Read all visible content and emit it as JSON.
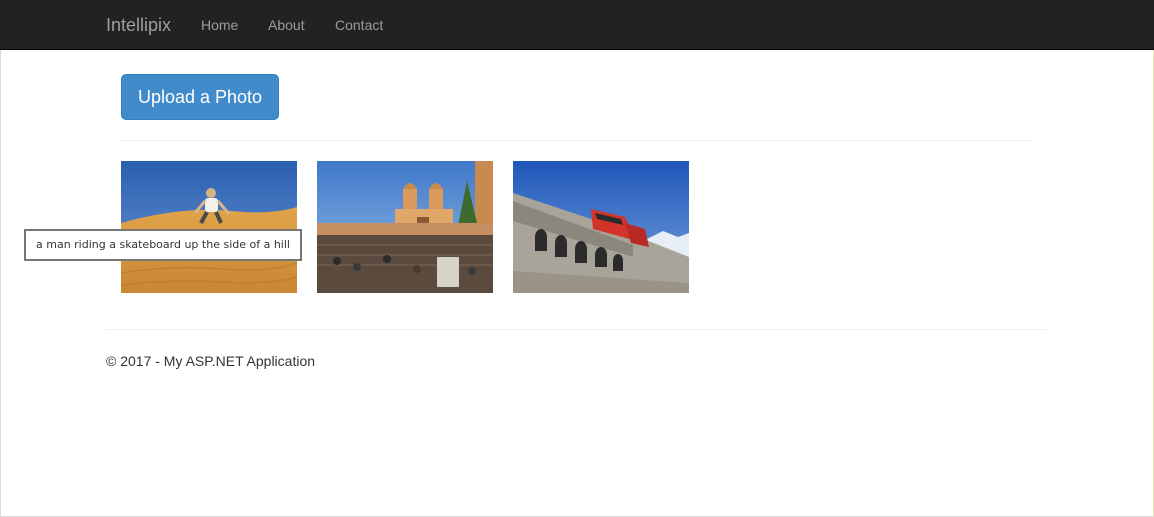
{
  "navbar": {
    "brand": "Intellipix",
    "links": [
      "Home",
      "About",
      "Contact"
    ]
  },
  "main": {
    "upload_label": "Upload a Photo",
    "photos": [
      {
        "description": "desert dune with man"
      },
      {
        "description": "church with steps and crowd"
      },
      {
        "description": "red train on stone viaduct"
      }
    ],
    "tooltip": "a man riding a skateboard up the side of a hill"
  },
  "footer": {
    "text": "© 2017 - My ASP.NET Application"
  },
  "colors": {
    "navbar_bg": "#222222",
    "nav_text": "#9d9d9d",
    "primary_button": "#428bca",
    "body_text": "#333333"
  }
}
